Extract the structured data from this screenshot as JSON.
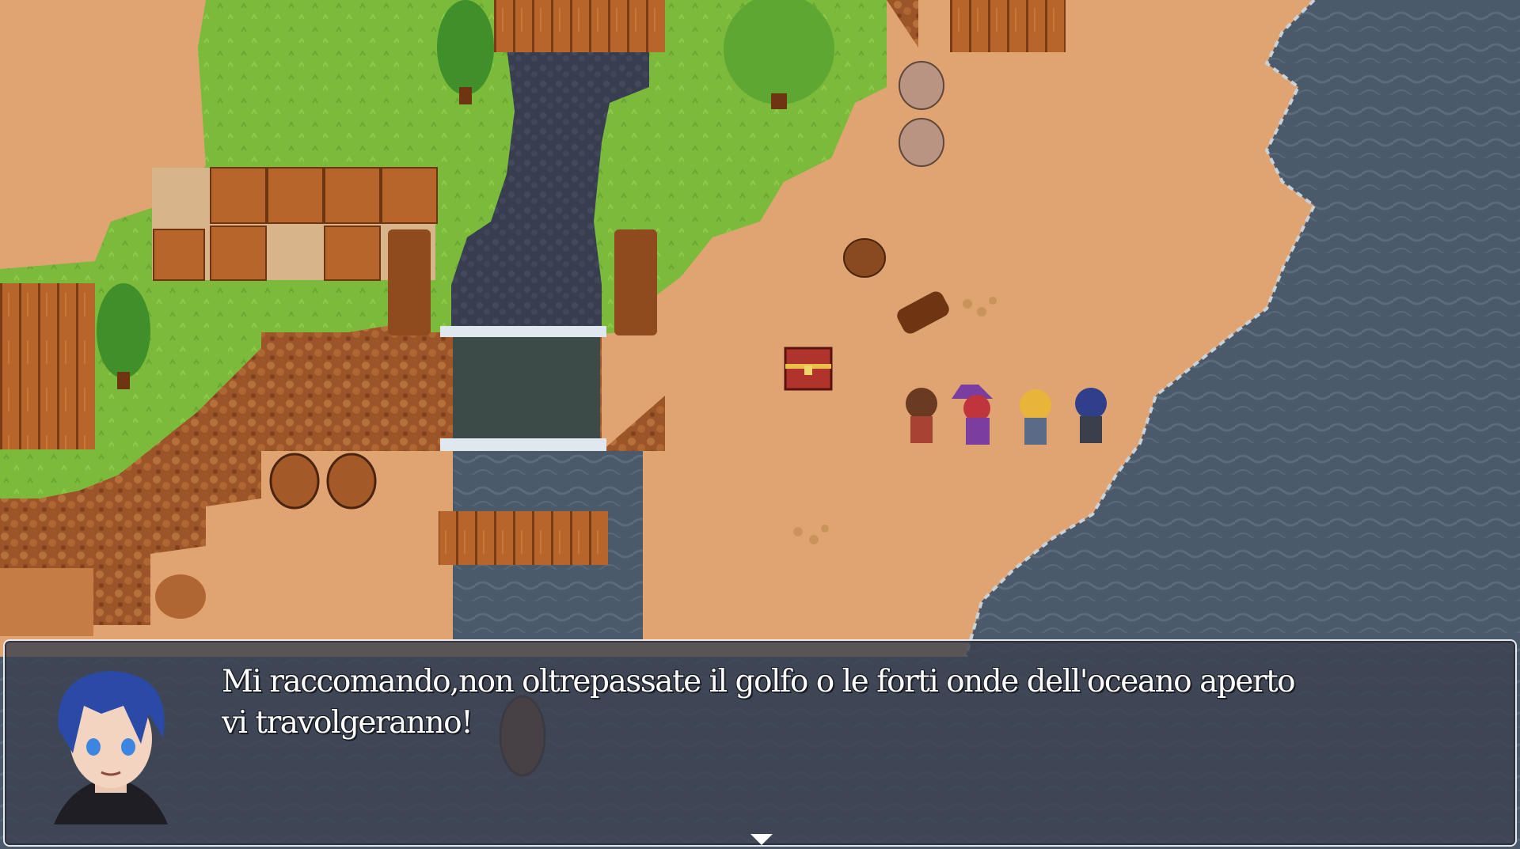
{
  "game": {
    "scene": "coastal-village-map",
    "palette": {
      "sand": "#e0a472",
      "grass": "#7cba3c",
      "water": "#4b5a6a",
      "river": "#3b4152",
      "cliff": "#a5602f",
      "wood": "#b8652c"
    },
    "party": [
      {
        "sprite": "brown-hair-hero-sprite"
      },
      {
        "sprite": "witch-hat-mage-sprite"
      },
      {
        "sprite": "blonde-swordsman-sprite"
      },
      {
        "sprite": "blue-hair-rogue-sprite"
      }
    ]
  },
  "dialog": {
    "speaker_portrait": "blue-hair-character-portrait",
    "line1": "Mi raccomando,non oltrepassate il golfo o le forti onde dell'oceano aperto",
    "line2": "vi travolgeranno!",
    "continue_icon": "triangle-down-icon"
  }
}
